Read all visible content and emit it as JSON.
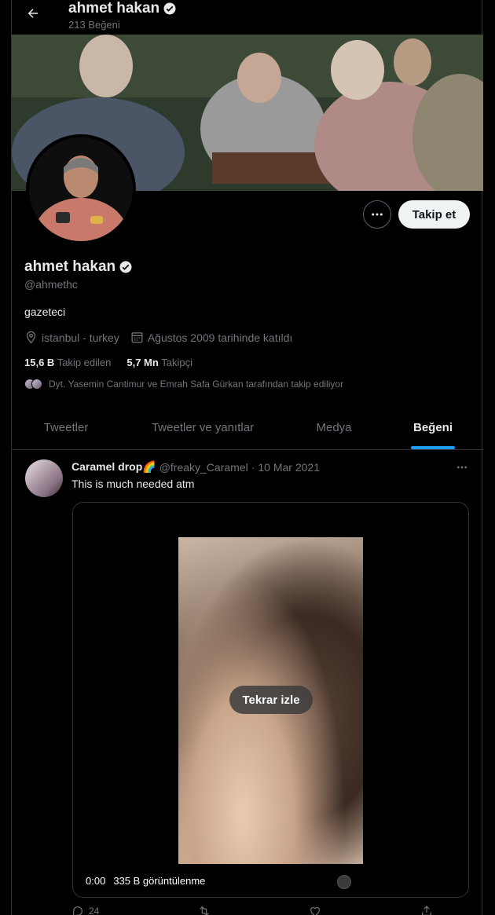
{
  "header": {
    "name": "ahmet hakan",
    "subtitle": "213 Beğeni"
  },
  "profile": {
    "name": "ahmet hakan",
    "handle": "@ahmethc",
    "bio": "gazeteci",
    "location": "istanbul - turkey",
    "joined": "Ağustos 2009 tarihinde katıldı",
    "following_count": "15,6 B",
    "following_label": "Takip edilen",
    "followers_count": "5,7 Mn",
    "followers_label": "Takipçi",
    "followed_by": "Dyt. Yasemin Cantimur ve Emrah Safa Gürkan tarafından takip ediliyor",
    "follow_label": "Takip et"
  },
  "tabs": [
    {
      "label": "Tweetler"
    },
    {
      "label": "Tweetler ve yanıtlar"
    },
    {
      "label": "Medya"
    },
    {
      "label": "Beğeni"
    }
  ],
  "tweet": {
    "author": "Caramel drop🌈",
    "handle": "@freaky_Caramel",
    "sep": "·",
    "date": "10 Mar 2021",
    "text": "This is much needed atm",
    "replay_label": "Tekrar izle",
    "time": "0:00",
    "views": "335 B görüntülenme",
    "reply_count": "24"
  },
  "colors": {
    "accent": "#1d9bf0",
    "background": "#000000",
    "border": "#2f3336",
    "muted": "#71767b"
  }
}
